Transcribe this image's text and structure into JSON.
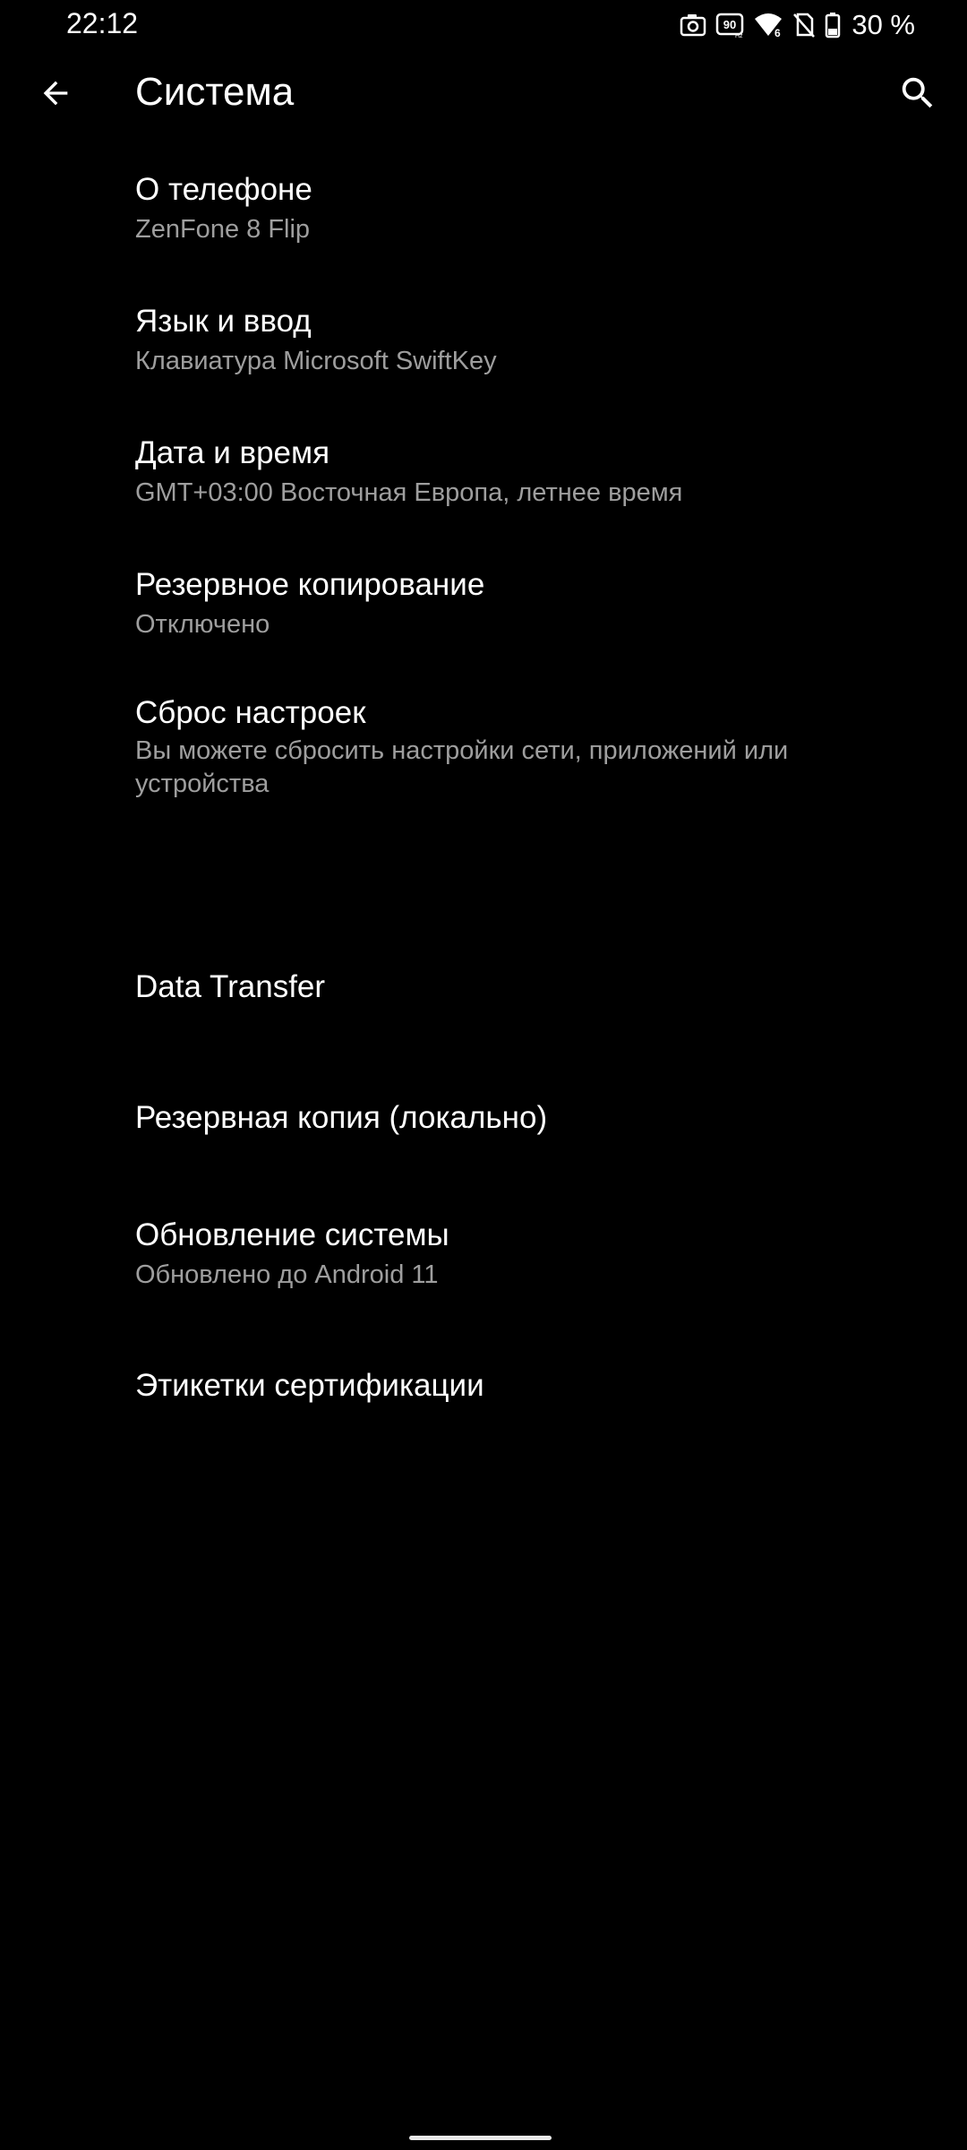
{
  "status_bar": {
    "time": "22:12",
    "battery_text": "30 %",
    "icons": [
      "screenshot-icon",
      "refresh-rate-90hz-icon",
      "wifi-6-icon",
      "no-sim-icon",
      "battery-icon"
    ]
  },
  "app_bar": {
    "title": "Система",
    "back_icon": "arrow-back-icon",
    "search_icon": "search-icon"
  },
  "settings": {
    "items": [
      {
        "title": "О телефоне",
        "summary": "ZenFone 8 Flip"
      },
      {
        "title": "Язык и ввод",
        "summary": "Клавиатура Microsoft SwiftKey"
      },
      {
        "title": "Дата и время",
        "summary": "GMT+03:00 Восточная Европа, летнее время"
      },
      {
        "title": "Резервное копирование",
        "summary": "Отключено"
      },
      {
        "title": "Сброс настроек",
        "summary": "Вы можете сбросить настройки сети, приложений или устройства"
      },
      {
        "title": "Data Transfer"
      },
      {
        "title": "Резервная копия (локально)"
      },
      {
        "title": "Обновление системы",
        "summary": "Обновлено до Android 11"
      },
      {
        "title": "Этикетки сертификации"
      }
    ]
  },
  "colors": {
    "background": "#000000",
    "primary_text": "#ffffff",
    "secondary_text": "#9e9e9e"
  }
}
